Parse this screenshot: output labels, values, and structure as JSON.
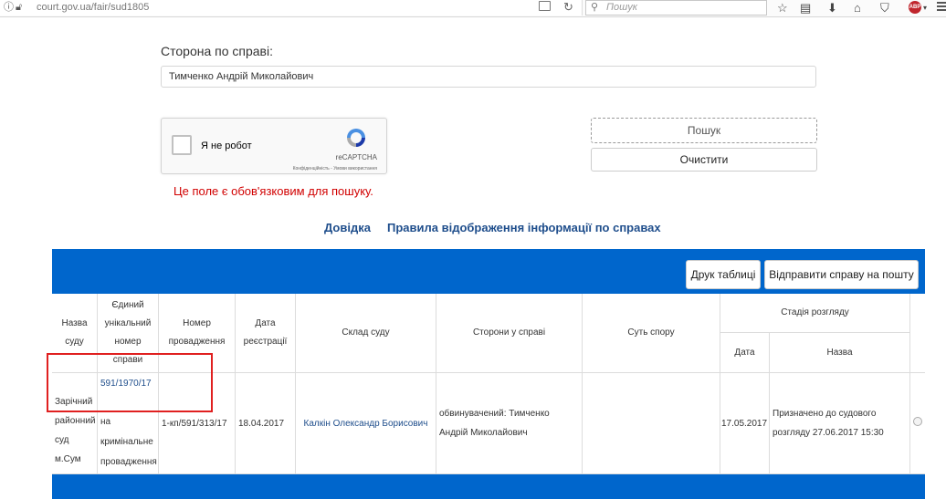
{
  "browser": {
    "url": "court.gov.ua/fair/sud1805",
    "search_placeholder": "Пошук"
  },
  "form": {
    "party_label": "Сторона по справі:",
    "party_value": "Тимченко Андрій Миколайович",
    "captcha": {
      "label": "Я не робот",
      "brand": "reCAPTCHA",
      "links": "Конфіденційність - Умови використання"
    },
    "search_button": "Пошук",
    "clear_button": "Очистити",
    "error": "Це поле є обов'язковим для пошуку."
  },
  "links": {
    "help": "Довідка",
    "rules": "Правила відображення інформації по справах"
  },
  "panel": {
    "print_button": "Друк таблиці",
    "send_button": "Відправити справу на пошту"
  },
  "table": {
    "headers": {
      "court_name": "Назва суду",
      "case_number": "Єдиний унікальний номер справи",
      "proceeding_number": "Номер провадження",
      "registration_date": "Дата реєстрації",
      "court_composition": "Склад суду",
      "parties": "Сторони у справі",
      "dispute": "Суть спору",
      "stage": "Стадія розгляду",
      "stage_date": "Дата",
      "stage_name": "Назва"
    },
    "rows": [
      {
        "court_name": "Зарічний районний суд м.Сум",
        "case_number": "591/1970/17",
        "case_type": "на кримінальне провадження",
        "proceeding_number": "1-кп/591/313/17",
        "registration_date": "18.04.2017",
        "court_composition": "Калкін Олександр Борисович",
        "parties": "обвинувачений: Тимченко Андрій Миколайович",
        "dispute": "",
        "stage_date": "17.05.2017",
        "stage_name": "Призначено до судового розгляду 27.06.2017 15:30"
      }
    ]
  },
  "colors": {
    "panel_blue": "#0066cc",
    "link_blue": "#1f4e8c",
    "error_red": "#d10000",
    "highlight_red": "#e02020"
  }
}
